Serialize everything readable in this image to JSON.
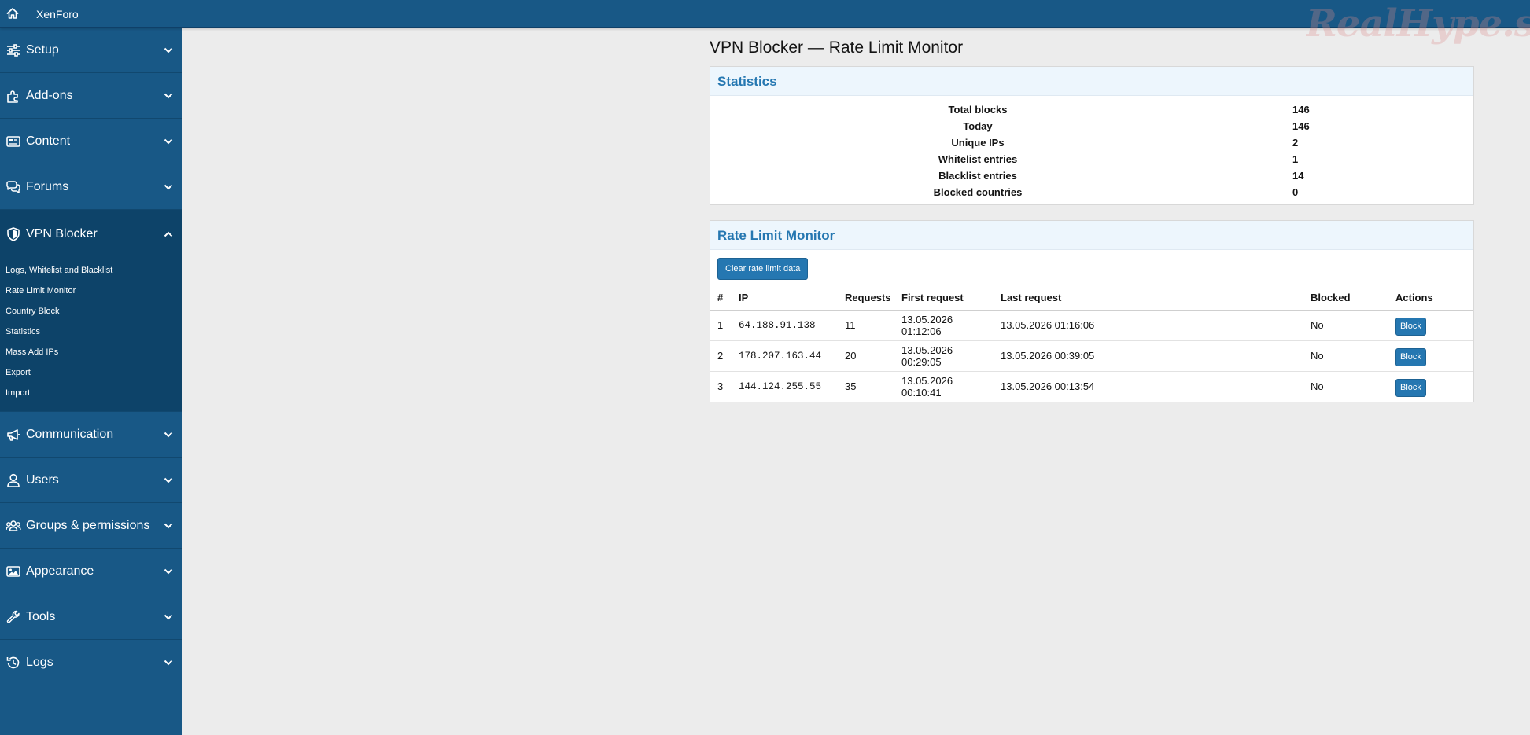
{
  "topbar": {
    "home_icon": "home-icon",
    "brand": "XenForo",
    "watermark": "RealHype.site"
  },
  "sidebar": {
    "items": [
      {
        "label": "Setup",
        "icon": "sliders-icon"
      },
      {
        "label": "Add-ons",
        "icon": "puzzle-icon"
      },
      {
        "label": "Content",
        "icon": "newspaper-icon"
      },
      {
        "label": "Forums",
        "icon": "comments-icon"
      },
      {
        "label": "VPN Blocker",
        "icon": "shield-icon",
        "expanded": true,
        "sub": [
          "Logs, Whitelist and Blacklist",
          "Rate Limit Monitor",
          "Country Block",
          "Statistics",
          "Mass Add IPs",
          "Export",
          "Import"
        ]
      },
      {
        "label": "Communication",
        "icon": "megaphone-icon"
      },
      {
        "label": "Users",
        "icon": "user-icon"
      },
      {
        "label": "Groups & permissions",
        "icon": "users-icon"
      },
      {
        "label": "Appearance",
        "icon": "image-icon"
      },
      {
        "label": "Tools",
        "icon": "wrench-icon"
      },
      {
        "label": "Logs",
        "icon": "history-icon"
      }
    ]
  },
  "page": {
    "title": "VPN Blocker — Rate Limit Monitor"
  },
  "statistics": {
    "header": "Statistics",
    "rows": [
      {
        "label": "Total blocks",
        "value": "146"
      },
      {
        "label": "Today",
        "value": "146"
      },
      {
        "label": "Unique IPs",
        "value": "2"
      },
      {
        "label": "Whitelist entries",
        "value": "1"
      },
      {
        "label": "Blacklist entries",
        "value": "14"
      },
      {
        "label": "Blocked countries",
        "value": "0"
      }
    ]
  },
  "rate_limit": {
    "header": "Rate Limit Monitor",
    "clear_button": "Clear rate limit data",
    "columns": [
      "#",
      "IP",
      "Requests",
      "First request",
      "Last request",
      "Blocked",
      "Actions"
    ],
    "rows": [
      {
        "n": "1",
        "ip": "64.188.91.138",
        "requests": "11",
        "first": "13.05.2026 01:12:06",
        "last": "13.05.2026 01:16:06",
        "blocked": "No",
        "action": "Block"
      },
      {
        "n": "2",
        "ip": "178.207.163.44",
        "requests": "20",
        "first": "13.05.2026 00:29:05",
        "last": "13.05.2026 00:39:05",
        "blocked": "No",
        "action": "Block"
      },
      {
        "n": "3",
        "ip": "144.124.255.55",
        "requests": "35",
        "first": "13.05.2026 00:10:41",
        "last": "13.05.2026 00:13:54",
        "blocked": "No",
        "action": "Block"
      }
    ]
  },
  "colors": {
    "accent": "#185886",
    "primary_button": "#2577b1",
    "sidebar_active": "#0d4369",
    "background": "#ececec"
  }
}
